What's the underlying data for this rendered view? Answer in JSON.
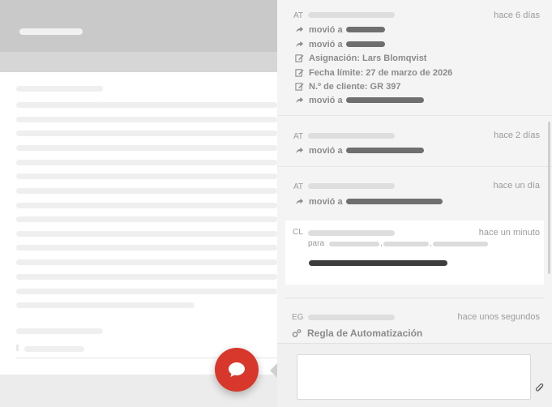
{
  "panel": {
    "entries": [
      {
        "initials": "AT",
        "time": "hace 6 días",
        "lines": [
          {
            "icon": "share-arrow-icon",
            "text": "movió a"
          },
          {
            "icon": "share-arrow-icon",
            "text": "movió a"
          },
          {
            "icon": "edit-icon",
            "text": "Asignación: Lars Blomqvist"
          },
          {
            "icon": "edit-icon",
            "text": "Fecha límite: 27 de marzo de 2026"
          },
          {
            "icon": "edit-icon",
            "text": "N.º de cliente: GR 397"
          },
          {
            "icon": "share-arrow-icon",
            "text": "movió a"
          }
        ]
      },
      {
        "initials": "AT",
        "time": "hace 2 días",
        "lines": [
          {
            "icon": "share-arrow-icon",
            "text": "movió a"
          }
        ]
      },
      {
        "initials": "AT",
        "time": "hace un día",
        "lines": [
          {
            "icon": "share-arrow-icon",
            "text": "movió a"
          }
        ]
      },
      {
        "initials": "CL",
        "time": "hace un minuto",
        "para_label": "para"
      },
      {
        "initials": "EG",
        "time": "hace unos segundos",
        "lines": [
          {
            "icon": "cogs-icon",
            "text": "Regla de Automatización"
          }
        ]
      }
    ],
    "composer": {
      "placeholder": ""
    }
  },
  "icons": {
    "fab": "chat-bubble-icon",
    "attach": "paperclip-icon"
  },
  "colors": {
    "fab": "#d8382b",
    "panel_bg": "#f4f4f4",
    "overlay": "#c9c9c9"
  }
}
